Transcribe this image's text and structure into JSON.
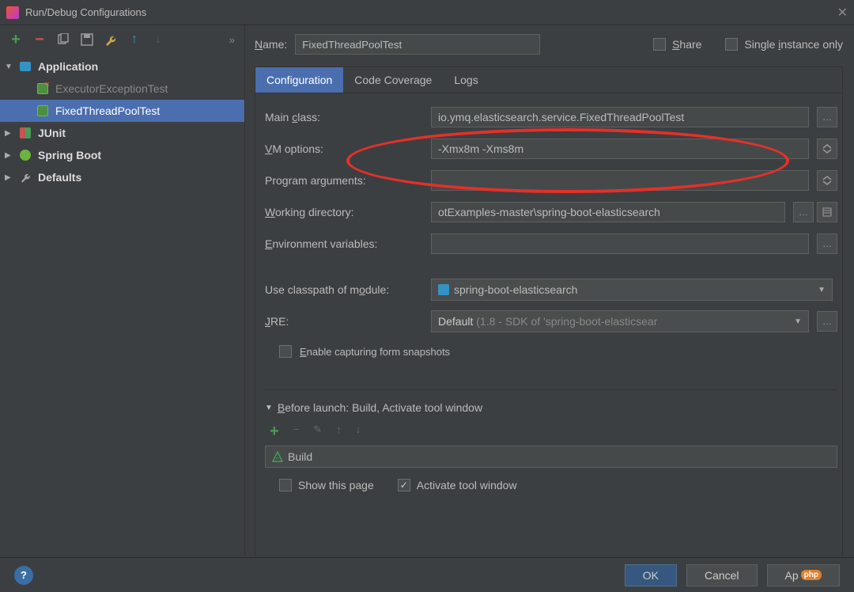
{
  "window": {
    "title": "Run/Debug Configurations"
  },
  "topbar": {
    "name_label": "Name:",
    "name_value": "FixedThreadPoolTest",
    "share_label": "Share",
    "single_label": "Single instance only"
  },
  "tree": {
    "application": "Application",
    "executor": "ExecutorExceptionTest",
    "fixed": "FixedThreadPoolTest",
    "junit": "JUnit",
    "spring": "Spring Boot",
    "defaults": "Defaults"
  },
  "tabs": {
    "configuration": "Configuration",
    "coverage": "Code Coverage",
    "logs": "Logs"
  },
  "form": {
    "main_class_label": "Main class:",
    "main_class_value": "io.ymq.elasticsearch.service.FixedThreadPoolTest",
    "vm_label": "VM options:",
    "vm_value": "-Xmx8m -Xms8m",
    "args_label": "Program arguments:",
    "args_value": "",
    "wd_label": "Working directory:",
    "wd_value": "otExamples-master\\spring-boot-elasticsearch",
    "env_label": "Environment variables:",
    "env_value": "",
    "classpath_label": "Use classpath of module:",
    "classpath_value": "spring-boot-elasticsearch",
    "jre_label": "JRE:",
    "jre_value": "Default (1.8 - SDK of 'spring-boot-elasticsear",
    "enable_snapshot": "Enable capturing form snapshots"
  },
  "before": {
    "title": "Before launch: Build, Activate tool window",
    "build": "Build",
    "show_page": "Show this page",
    "activate": "Activate tool window"
  },
  "buttons": {
    "ok": "OK",
    "cancel": "Cancel",
    "apply": "Ap",
    "php": "php"
  }
}
